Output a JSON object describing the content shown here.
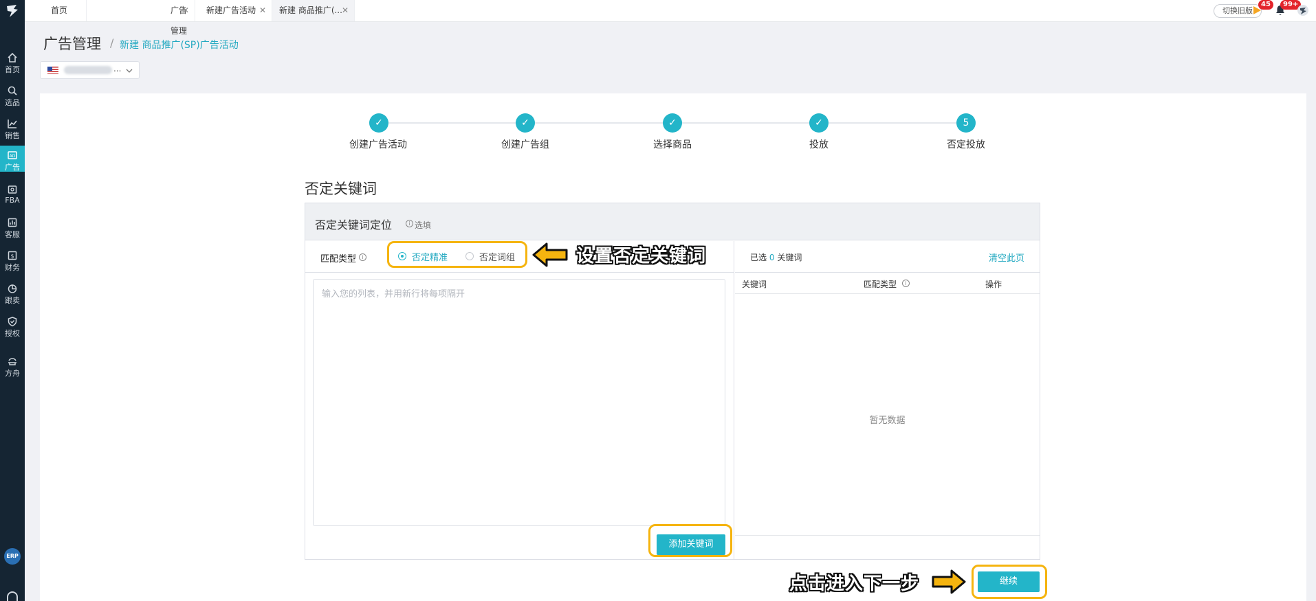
{
  "sidebar": {
    "items": [
      {
        "label": "首页",
        "icon": "home-icon"
      },
      {
        "label": "选品",
        "icon": "search-icon"
      },
      {
        "label": "销售",
        "icon": "chart-icon"
      },
      {
        "label": "广告",
        "icon": "ad-icon",
        "active": true
      },
      {
        "label": "FBA",
        "icon": "box-icon"
      },
      {
        "label": "客服",
        "icon": "service-icon"
      },
      {
        "label": "财务",
        "icon": "finance-icon"
      },
      {
        "label": "跟卖",
        "icon": "pie-icon"
      },
      {
        "label": "授权",
        "icon": "shield-icon"
      },
      {
        "label": "方舟",
        "icon": "ark-icon"
      }
    ],
    "erp": "ERP"
  },
  "tabs": [
    {
      "label": "首页"
    },
    {
      "label": "广告管理"
    },
    {
      "label": "新建广告活动"
    },
    {
      "label": "新建 商品推广(..."
    }
  ],
  "topbar": {
    "old_version": "切换旧版",
    "flag_badge": "45",
    "bell_badge": "99+"
  },
  "header": {
    "title": "广告管理",
    "separator": "/",
    "breadcrumb": "新建 商品推广(SP)广告活动",
    "store_ellipsis": "..."
  },
  "steps": [
    {
      "label": "创建广告活动",
      "mark": "✓"
    },
    {
      "label": "创建广告组",
      "mark": "✓"
    },
    {
      "label": "选择商品",
      "mark": "✓"
    },
    {
      "label": "投放",
      "mark": "✓"
    },
    {
      "label": "否定投放",
      "mark": "5"
    }
  ],
  "section": {
    "title": "否定关键词",
    "box_title": "否定关键词定位",
    "optional": "选填"
  },
  "match": {
    "label": "匹配类型",
    "options": [
      "否定精准",
      "否定词组"
    ],
    "selected": "否定精准"
  },
  "input": {
    "placeholder": "输入您的列表，并用新行将每项隔开"
  },
  "buttons": {
    "add_keywords": "添加关键词",
    "continue": "继续",
    "clear_page": "清空此页"
  },
  "selected": {
    "prefix": "已选",
    "count": "0",
    "suffix": "关键词"
  },
  "table": {
    "columns": [
      "关键词",
      "匹配类型",
      "操作"
    ],
    "empty": "暂无数据"
  },
  "annotations": {
    "set_negative": "设置否定关键词",
    "next_step": "点击进入下一步"
  },
  "colors": {
    "accent": "#23b5c9",
    "sidebar": "#152533",
    "highlight": "#f5b40f"
  }
}
